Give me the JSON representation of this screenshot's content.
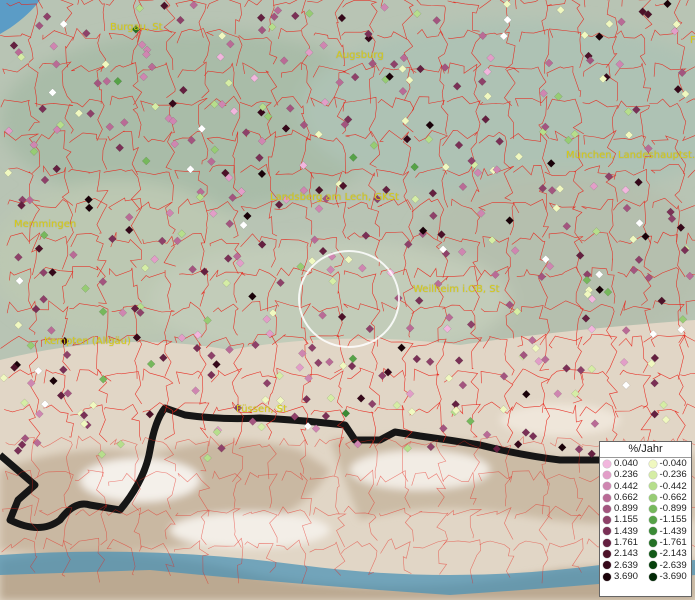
{
  "map": {
    "labels": {
      "burgau": "Burgau, St",
      "augsburg": "Augsburg",
      "muenchen": "München, Landeshauptst.",
      "landsberg": "Landsberg am Lech, GKSt",
      "memmingen": "Memmingen",
      "weilheim": "Weilheim i.OB, St",
      "kempten": "Kempten (Allgäu)",
      "fuessen": "Füssen, St",
      "edge_f": "F"
    },
    "colors": {
      "boundaries": "#e8231a",
      "labels": "#d8cc18",
      "highlight_circle": "#ffffff"
    },
    "legend": {
      "title": "%/Jahr",
      "positive": [
        {
          "label": "0.040",
          "color": "#f1b6dd"
        },
        {
          "label": "0.236",
          "color": "#e29ec8"
        },
        {
          "label": "0.442",
          "color": "#cf86b1"
        },
        {
          "label": "0.662",
          "color": "#b96b96"
        },
        {
          "label": "0.899",
          "color": "#a3557f"
        },
        {
          "label": "1.155",
          "color": "#8e4169"
        },
        {
          "label": "1.439",
          "color": "#7a3056"
        },
        {
          "label": "1.761",
          "color": "#642040"
        },
        {
          "label": "2.143",
          "color": "#4d1229"
        },
        {
          "label": "2.639",
          "color": "#36081a"
        },
        {
          "label": "3.690",
          "color": "#1a0209"
        }
      ],
      "negative": [
        {
          "label": "-0.040",
          "color": "#f0f8c0"
        },
        {
          "label": "-0.236",
          "color": "#d5eda5"
        },
        {
          "label": "-0.442",
          "color": "#b6de8c"
        },
        {
          "label": "-0.662",
          "color": "#97cc74"
        },
        {
          "label": "-0.899",
          "color": "#76b85c"
        },
        {
          "label": "-1.155",
          "color": "#56a247"
        },
        {
          "label": "-1.439",
          "color": "#3a8a35"
        },
        {
          "label": "-1.761",
          "color": "#257126"
        },
        {
          "label": "-2.143",
          "color": "#135a18"
        },
        {
          "label": "-2.639",
          "color": "#06400c"
        },
        {
          "label": "-3.690",
          "color": "#022806"
        }
      ],
      "extra_symbol": {
        "label": "white point",
        "color": "#ffffff"
      }
    }
  }
}
